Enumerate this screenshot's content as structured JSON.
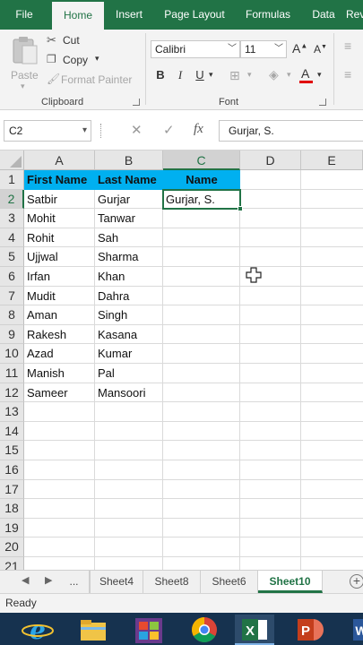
{
  "ribbon": {
    "tabs": [
      "File",
      "Home",
      "Insert",
      "Page Layout",
      "Formulas",
      "Data",
      "Rev"
    ],
    "active_tab": "Home",
    "clipboard": {
      "paste": "Paste",
      "cut": "Cut",
      "copy": "Copy",
      "format_painter": "Format Painter",
      "label": "Clipboard"
    },
    "font": {
      "name": "Calibri",
      "size": "11",
      "grow": "A",
      "shrink": "A",
      "bold": "B",
      "italic": "I",
      "underline": "U",
      "font_color": "A",
      "label": "Font"
    }
  },
  "formula_bar": {
    "name_box": "C2",
    "cancel": "✕",
    "enter": "✓",
    "fx": "fx",
    "value": "Gurjar, S."
  },
  "sheet": {
    "columns": [
      "A",
      "B",
      "C",
      "D",
      "E"
    ],
    "selected_column": "C",
    "rows": [
      "1",
      "2",
      "3",
      "4",
      "5",
      "6",
      "7",
      "8",
      "9",
      "10",
      "11",
      "12",
      "13",
      "14",
      "15",
      "16",
      "17",
      "18",
      "19",
      "20",
      "21"
    ],
    "selected_row": "2",
    "header": {
      "first_name": "First Name",
      "last_name": "Last Name",
      "name": "Name"
    },
    "data": [
      {
        "first": "Satbir",
        "last": "Gurjar",
        "name": "Gurjar, S."
      },
      {
        "first": "Mohit",
        "last": "Tanwar",
        "name": ""
      },
      {
        "first": "Rohit",
        "last": "Sah",
        "name": ""
      },
      {
        "first": "Ujjwal",
        "last": "Sharma",
        "name": ""
      },
      {
        "first": "Irfan",
        "last": "Khan",
        "name": ""
      },
      {
        "first": "Mudit",
        "last": "Dahra",
        "name": ""
      },
      {
        "first": "Aman",
        "last": "Singh",
        "name": ""
      },
      {
        "first": "Rakesh",
        "last": "Kasana",
        "name": ""
      },
      {
        "first": "Azad",
        "last": "Kumar",
        "name": ""
      },
      {
        "first": "Manish",
        "last": "Pal",
        "name": ""
      },
      {
        "first": "Sameer",
        "last": "Mansoori",
        "name": ""
      }
    ]
  },
  "sheet_tabs": {
    "ellipsis": "...",
    "tabs": [
      "Sheet4",
      "Sheet8",
      "Sheet6",
      "Sheet10"
    ],
    "active": "Sheet10",
    "add": "+"
  },
  "status": {
    "text": "Ready"
  },
  "colors": {
    "excel_green": "#217346",
    "header_fill": "#00b0f0",
    "taskbar": "#16324f"
  },
  "taskbar": {
    "apps": [
      "ie-icon",
      "file-explorer-icon",
      "store-icon",
      "chrome-icon",
      "excel-icon",
      "powerpoint-icon",
      "word-icon"
    ],
    "active": "excel-icon"
  }
}
